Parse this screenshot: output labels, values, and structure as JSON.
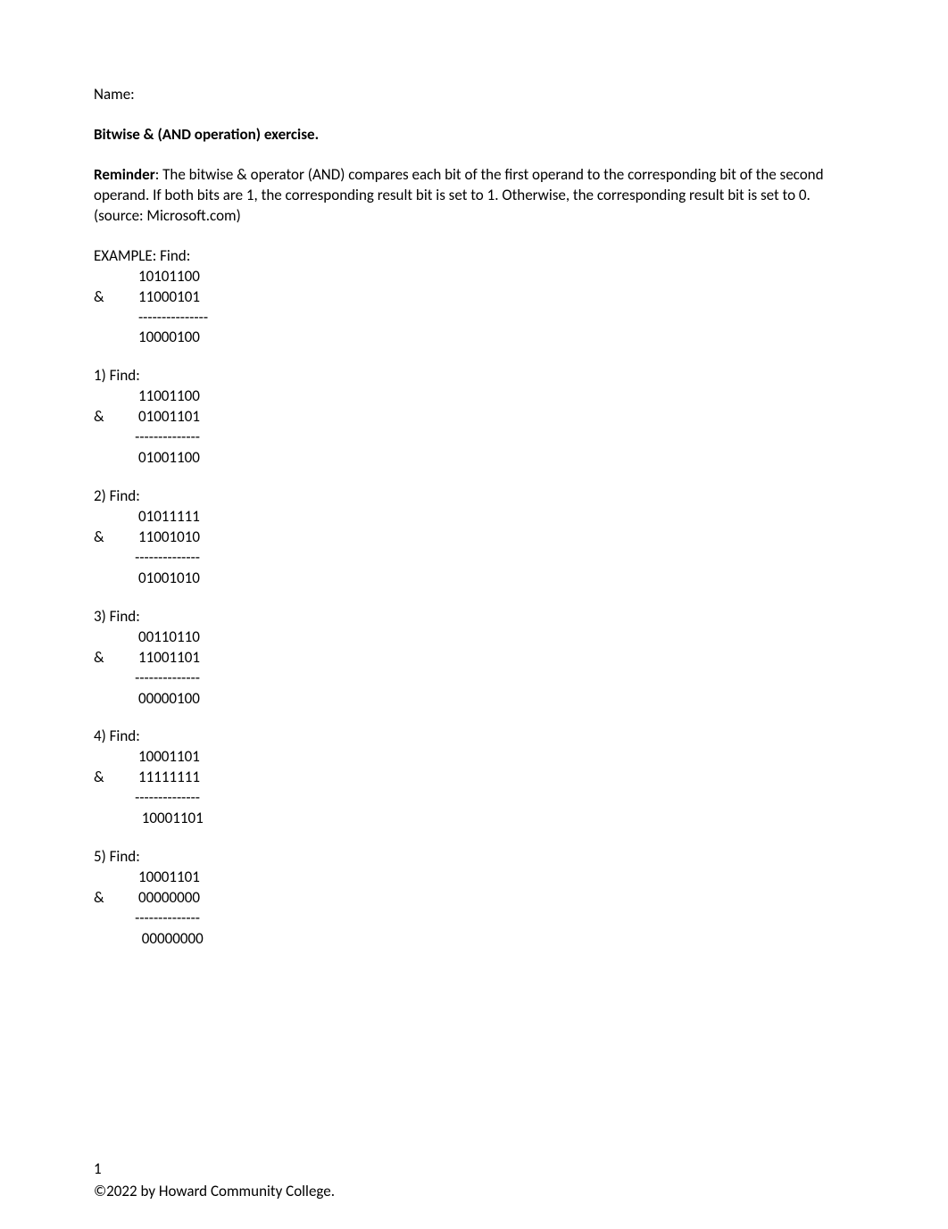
{
  "name_label": "Name:",
  "title": "Bitwise & (AND operation) exercise.",
  "reminder_label": "Reminder",
  "reminder_text": ": The bitwise & operator (AND) compares each bit of the first operand to the corresponding bit of the second operand. If both bits are 1, the corresponding result bit is set to 1. Otherwise, the corresponding result bit is set to 0.   (source: Microsoft.com)",
  "example": {
    "header": "EXAMPLE:  Find:",
    "line1": "             10101100",
    "line2": "&          11000101",
    "sep": "             ---------------",
    "result": "             10000100"
  },
  "problems": [
    {
      "header": "1)   Find:",
      "line1": "             11001100",
      "line2": "&          01001101",
      "sep": "            --------------",
      "result": "             01001100"
    },
    {
      "header": "2)   Find:",
      "line1": "             01011111",
      "line2": "&          11001010",
      "sep": "            --------------",
      "result": "             01001010"
    },
    {
      "header": "3)   Find:",
      "line1": "             00110110",
      "line2": "&          11001101",
      "sep": "            --------------",
      "result": "             00000100"
    },
    {
      "header": "4)   Find:",
      "line1": "             10001101",
      "line2": "&          11111111",
      "sep": "            --------------",
      "result": "              10001101"
    },
    {
      "header": "5)   Find:",
      "line1": "             10001101",
      "line2": "&          00000000",
      "sep": "            --------------",
      "result": "              00000000"
    }
  ],
  "footer": {
    "page_number": "1",
    "copyright": "©2022 by Howard Community College."
  }
}
